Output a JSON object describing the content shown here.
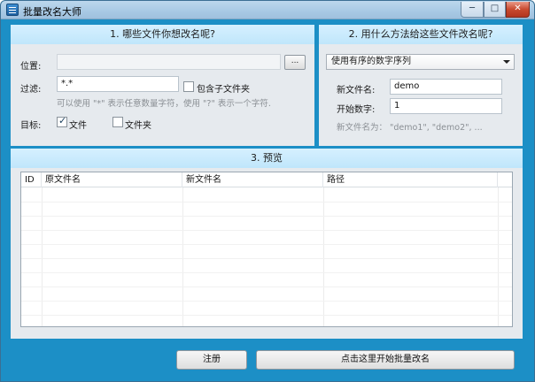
{
  "window": {
    "title": "批量改名大师",
    "min_glyph": "─",
    "max_glyph": "□",
    "close_glyph": "✕"
  },
  "section1": {
    "title": "1. 哪些文件你想改名呢?",
    "location_label": "位置:",
    "location_value": "",
    "browse_label": "...",
    "filter_label": "过滤:",
    "filter_value": "*.*",
    "include_subfolders_label": "包含子文件夹",
    "include_subfolders_checked": false,
    "filter_hint": "可以使用 \"*\" 表示任意数量字符，使用 \"?\" 表示一个字符.",
    "target_label": "目标:",
    "target_file_label": "文件",
    "target_file_checked": true,
    "target_folder_label": "文件夹",
    "target_folder_checked": false
  },
  "section2": {
    "title": "2. 用什么方法给这些文件改名呢?",
    "method_selected": "使用有序的数字序列",
    "new_name_label": "新文件名:",
    "new_name_value": "demo",
    "start_number_label": "开始数字:",
    "start_number_value": "1",
    "preview_hint": "新文件名为：  \"demo1\", \"demo2\", ..."
  },
  "section3": {
    "title": "3. 预览",
    "columns": [
      "ID",
      "原文件名",
      "新文件名",
      "路径"
    ],
    "rows": []
  },
  "footer": {
    "register_label": "注册",
    "start_label": "点击这里开始批量改名"
  },
  "colors": {
    "accent": "#1c8fc6",
    "panel": "#e6eaee",
    "panel_header": "#c9ebfd"
  }
}
